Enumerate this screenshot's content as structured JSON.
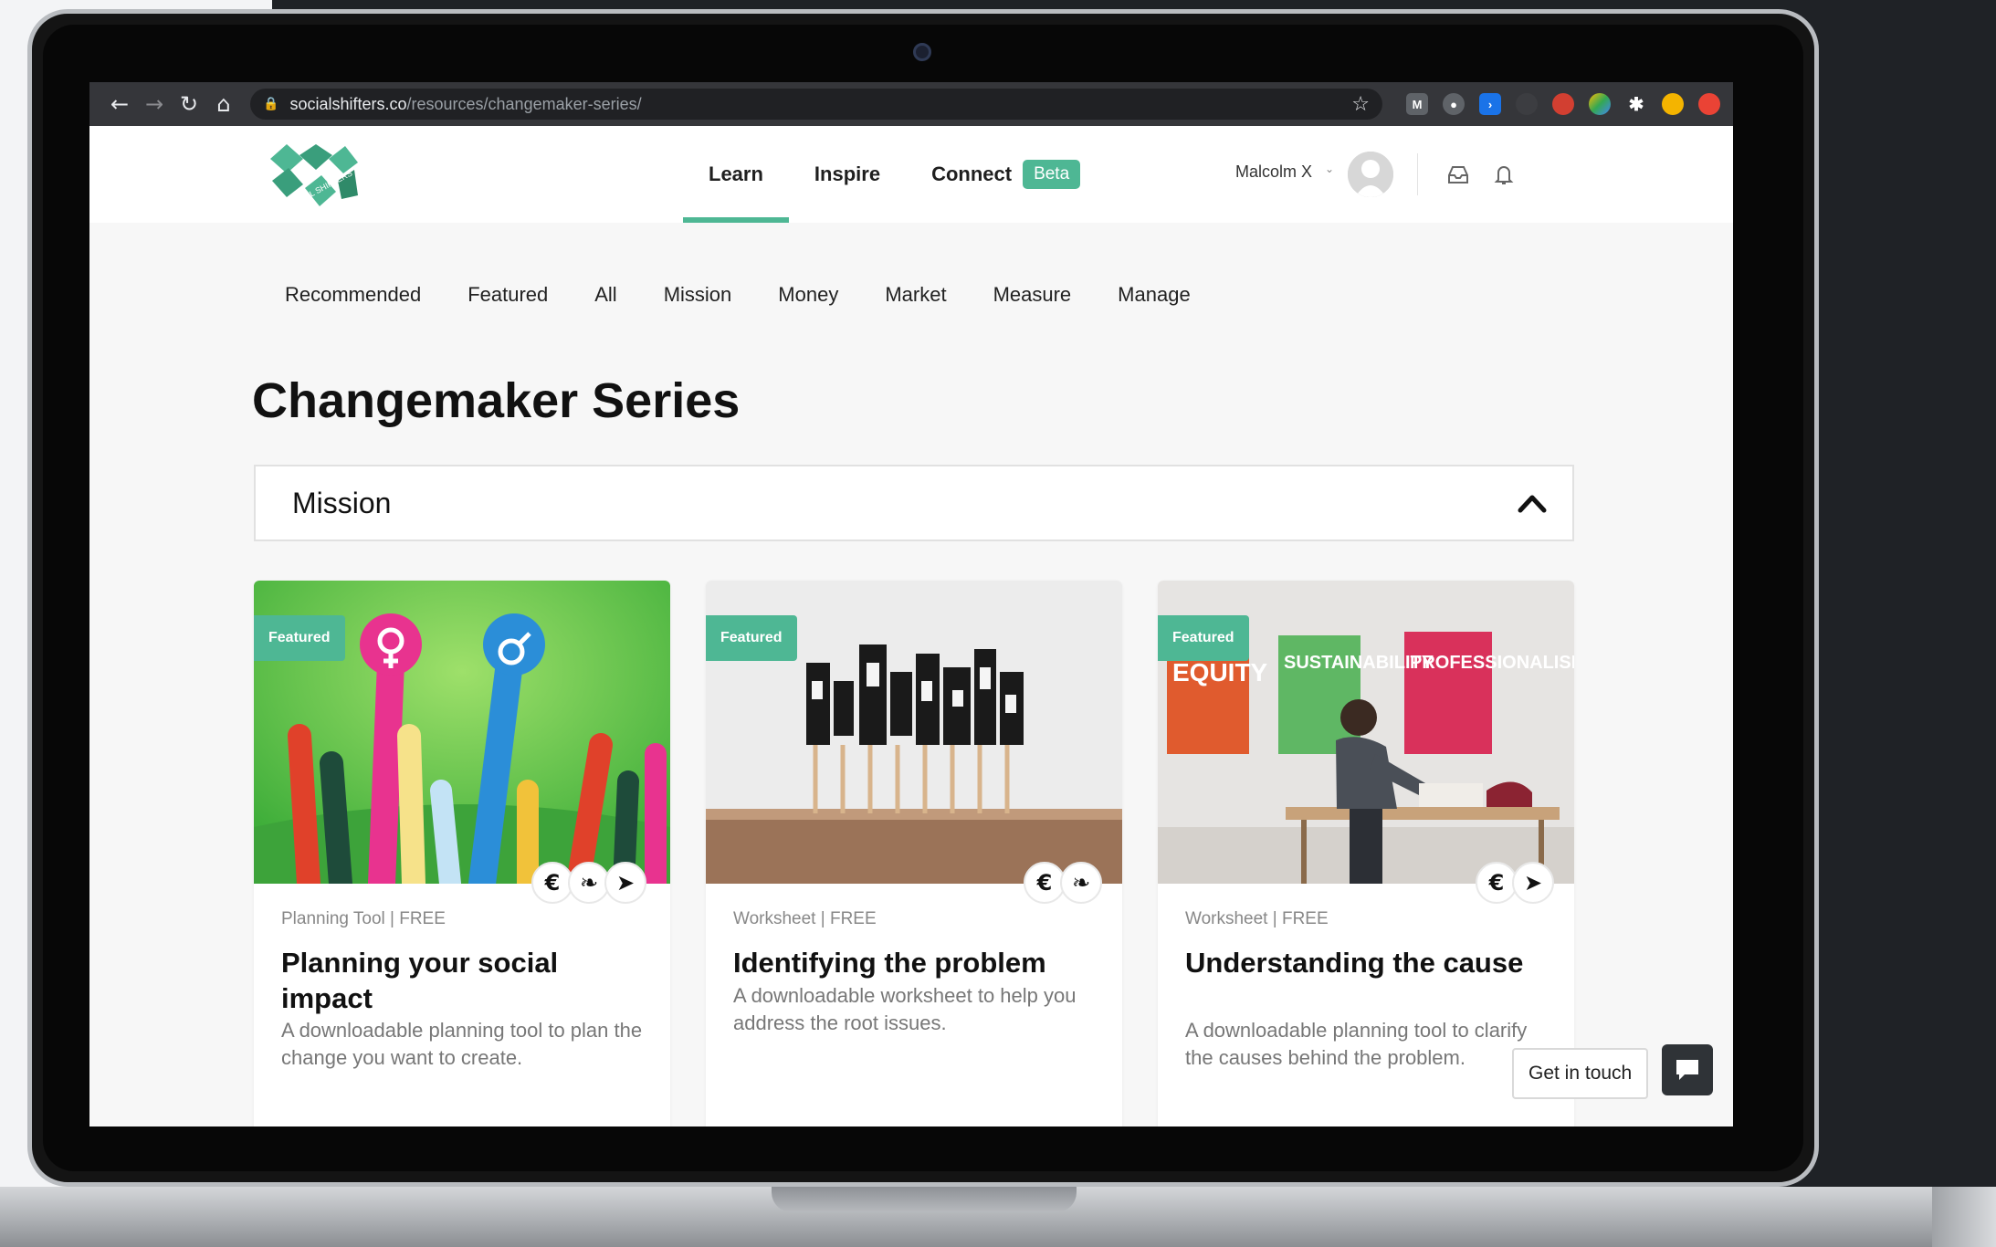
{
  "browser": {
    "url_host": "socialshifters.co",
    "url_path": "/resources/changemaker-series/"
  },
  "site": {
    "logo_text": "SOCIAL SHIFTERS",
    "nav": [
      {
        "label": "Learn"
      },
      {
        "label": "Inspire"
      },
      {
        "label": "Connect"
      }
    ],
    "beta_label": "Beta",
    "user_name": "Malcolm X",
    "accent_color": "#4eb794"
  },
  "categories": [
    "Recommended",
    "Featured",
    "All",
    "Mission",
    "Money",
    "Market",
    "Measure",
    "Manage"
  ],
  "page_title": "Changemaker Series",
  "accordion_title": "Mission",
  "cards": [
    {
      "badge": "Featured",
      "type": "Planning Tool | FREE",
      "title": "Planning your social impact",
      "description": "A downloadable planning tool to plan the change you want to create."
    },
    {
      "badge": "Featured",
      "type": "Worksheet | FREE",
      "title": "Identifying the problem",
      "description": "A downloadable worksheet to help you address the root issues."
    },
    {
      "badge": "Featured",
      "type": "Worksheet | FREE",
      "title": "Understanding the cause",
      "description": "A downloadable planning tool to clarify the causes behind the problem.",
      "poster_text": [
        "EQUITY",
        "SUSTAINABILITY",
        "PROFESSIONALISM"
      ]
    }
  ],
  "chat": {
    "label": "Get in touch"
  }
}
